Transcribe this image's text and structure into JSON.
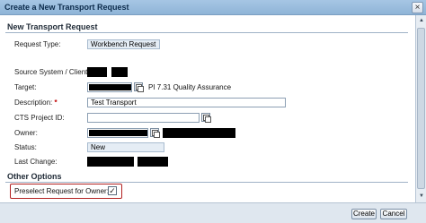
{
  "window": {
    "title": "Create a New Transport Request"
  },
  "section_main": {
    "title": "New Transport Request"
  },
  "fields": {
    "request_type": {
      "label": "Request Type:",
      "value": "Workbench Request"
    },
    "source_system": {
      "label": "Source System / Client:"
    },
    "target": {
      "label": "Target:",
      "description": "PI 7.31 Quality Assurance"
    },
    "description": {
      "label": "Description:",
      "required_marker": "*",
      "value": "Test Transport"
    },
    "cts_project": {
      "label": "CTS Project ID:",
      "value": ""
    },
    "owner": {
      "label": "Owner:"
    },
    "status": {
      "label": "Status:",
      "value": "New"
    },
    "last_change": {
      "label": "Last Change:"
    }
  },
  "section_options": {
    "title": "Other Options",
    "preselect_label": "Preselect Request for Owner:",
    "preselect_mark": "✓"
  },
  "buttons": {
    "create": "Create",
    "cancel": "Cancel"
  },
  "icons": {
    "close": "close-icon",
    "value_help": "value-help-icon",
    "scroll_up": "scroll-up-icon",
    "scroll_down": "scroll-down-icon"
  },
  "colors": {
    "titlebar": "#a6c6e4",
    "highlight_box": "#b22222",
    "footer": "#dfe7ef"
  }
}
